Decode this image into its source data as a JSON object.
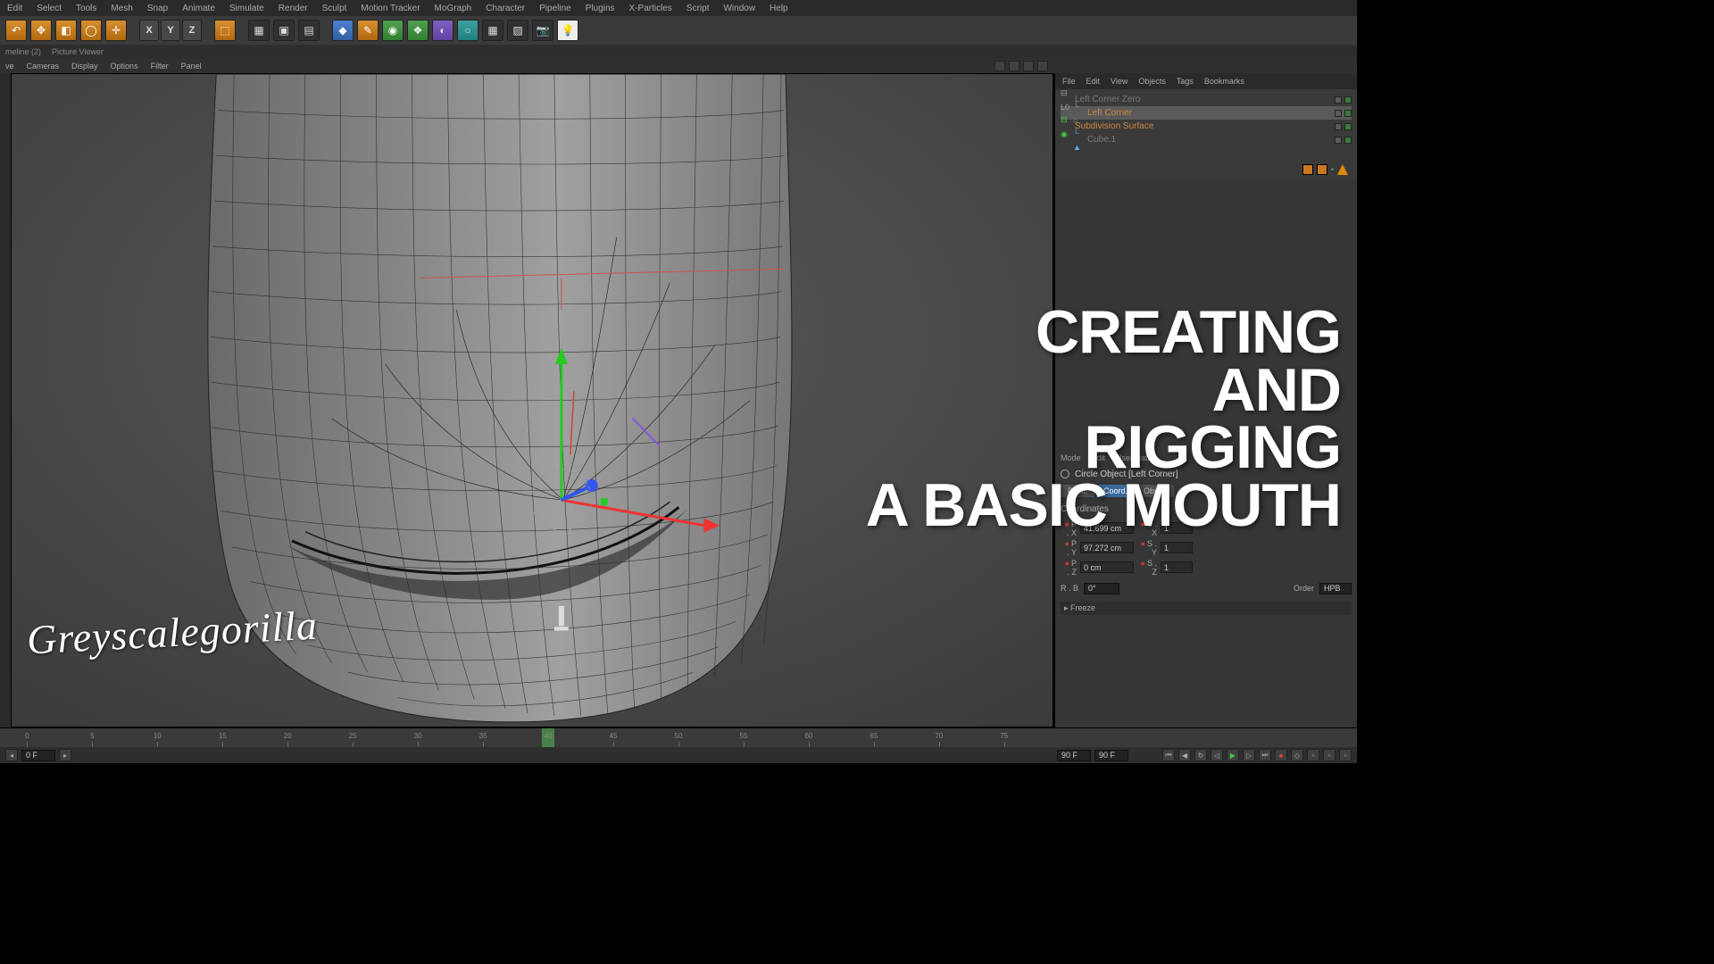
{
  "menubar": [
    "Edit",
    "Select",
    "Tools",
    "Mesh",
    "Snap",
    "Animate",
    "Simulate",
    "Render",
    "Sculpt",
    "Motion Tracker",
    "MoGraph",
    "Character",
    "Pipeline",
    "Plugins",
    "X-Particles",
    "Script",
    "Window",
    "Help"
  ],
  "toolbar": {
    "axes": [
      "X",
      "Y",
      "Z"
    ]
  },
  "tabrow": [
    "meline (2)",
    "Picture Viewer"
  ],
  "viewmenu": [
    "ve",
    "Cameras",
    "Display",
    "Options",
    "Filter",
    "Panel"
  ],
  "object_manager": {
    "menu": [
      "File",
      "Edit",
      "View",
      "Objects",
      "Tags",
      "Bookmarks"
    ],
    "items": [
      {
        "name": "Left Corner Zero",
        "cls": "name-gray",
        "indent": 0,
        "pre": "⊟ L0"
      },
      {
        "name": "Left Corner",
        "cls": "name-orange",
        "indent": 1,
        "pre": "└ ○",
        "sel": true
      },
      {
        "name": "Subdivision Surface",
        "cls": "name-orange",
        "indent": 0,
        "pre": "⊟ ◉"
      },
      {
        "name": "Cube.1",
        "cls": "name-gray",
        "indent": 1,
        "pre": "└ ▲"
      }
    ]
  },
  "attribute_manager": {
    "menu": [
      "Mode",
      "Edit",
      "User Data"
    ],
    "title": "Circle Object [Left Corner]",
    "tabs": [
      "Basic",
      "Coord.",
      "Object"
    ],
    "active_tab": 1,
    "section": "Coordinates",
    "coords": {
      "px": "41.699 cm",
      "sx": "1",
      "py": "97.272 cm",
      "sy": "1",
      "pz": "0 cm",
      "sz": "1",
      "rb": "0°"
    },
    "order_label": "Order",
    "order_value": "HPB",
    "freeze": "▸ Freeze"
  },
  "timeline": {
    "ticks": [
      0,
      5,
      10,
      15,
      20,
      25,
      30,
      35,
      40,
      45,
      50,
      55,
      60,
      65,
      70,
      75
    ],
    "cursor": 40,
    "start": "0 F",
    "end": "90 F",
    "current": "40 F",
    "range_end": "90 F"
  },
  "overlay": {
    "title_l1": "Creating",
    "title_l2": "and",
    "title_l3": "Rigging",
    "title_l4": "a Basic Mouth",
    "logo": "Greyscalegorilla"
  }
}
